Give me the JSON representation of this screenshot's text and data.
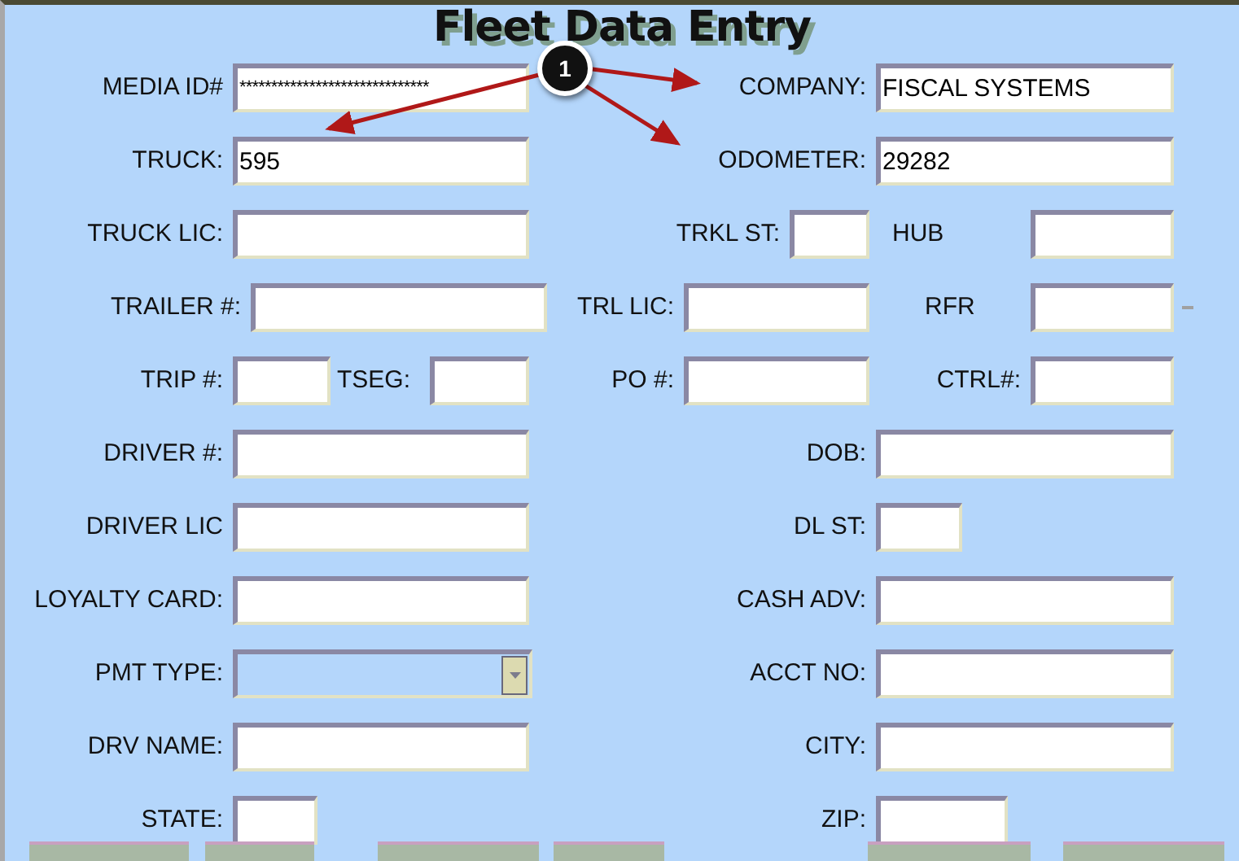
{
  "title": "Fleet Data Entry",
  "callout": {
    "label": "1"
  },
  "rows": [
    {
      "fields": [
        {
          "label": "MEDIA ID#",
          "value": "******************************",
          "kind": "masked"
        },
        {
          "label": "COMPANY:",
          "value": "FISCAL SYSTEMS",
          "kind": "text"
        }
      ]
    },
    {
      "fields": [
        {
          "label": "TRUCK:",
          "value": "595",
          "kind": "text"
        },
        {
          "label": "ODOMETER:",
          "value": "29282",
          "kind": "text"
        }
      ]
    },
    {
      "fields": [
        {
          "label": "TRUCK LIC:",
          "kind": "text"
        },
        {
          "label": "TRKL ST:",
          "kind": "text"
        },
        {
          "label": "HUB",
          "kind": "text"
        }
      ]
    },
    {
      "fields": [
        {
          "label": "TRAILER #:",
          "kind": "text"
        },
        {
          "label": "TRL LIC:",
          "kind": "text"
        },
        {
          "label": "RFR",
          "kind": "text"
        }
      ]
    },
    {
      "fields": [
        {
          "label": "TRIP #:",
          "kind": "text"
        },
        {
          "label": "TSEG:",
          "kind": "text"
        },
        {
          "label": "PO #:",
          "kind": "text"
        },
        {
          "label": "CTRL#:",
          "kind": "text"
        }
      ]
    },
    {
      "fields": [
        {
          "label": "DRIVER #:",
          "kind": "text"
        },
        {
          "label": "DOB:",
          "kind": "text"
        }
      ]
    },
    {
      "fields": [
        {
          "label": "DRIVER LIC",
          "kind": "text"
        },
        {
          "label": "DL ST:",
          "kind": "text"
        }
      ]
    },
    {
      "fields": [
        {
          "label": "LOYALTY CARD:",
          "kind": "text"
        },
        {
          "label": "CASH ADV:",
          "kind": "text"
        }
      ]
    },
    {
      "fields": [
        {
          "label": "PMT TYPE:",
          "kind": "dropdown"
        },
        {
          "label": "ACCT NO:",
          "kind": "text"
        }
      ]
    },
    {
      "fields": [
        {
          "label": "DRV NAME:",
          "kind": "text"
        },
        {
          "label": "CITY:",
          "kind": "text"
        }
      ]
    },
    {
      "fields": [
        {
          "label": "STATE:",
          "kind": "text"
        },
        {
          "label": "ZIP:",
          "kind": "text"
        }
      ]
    }
  ]
}
